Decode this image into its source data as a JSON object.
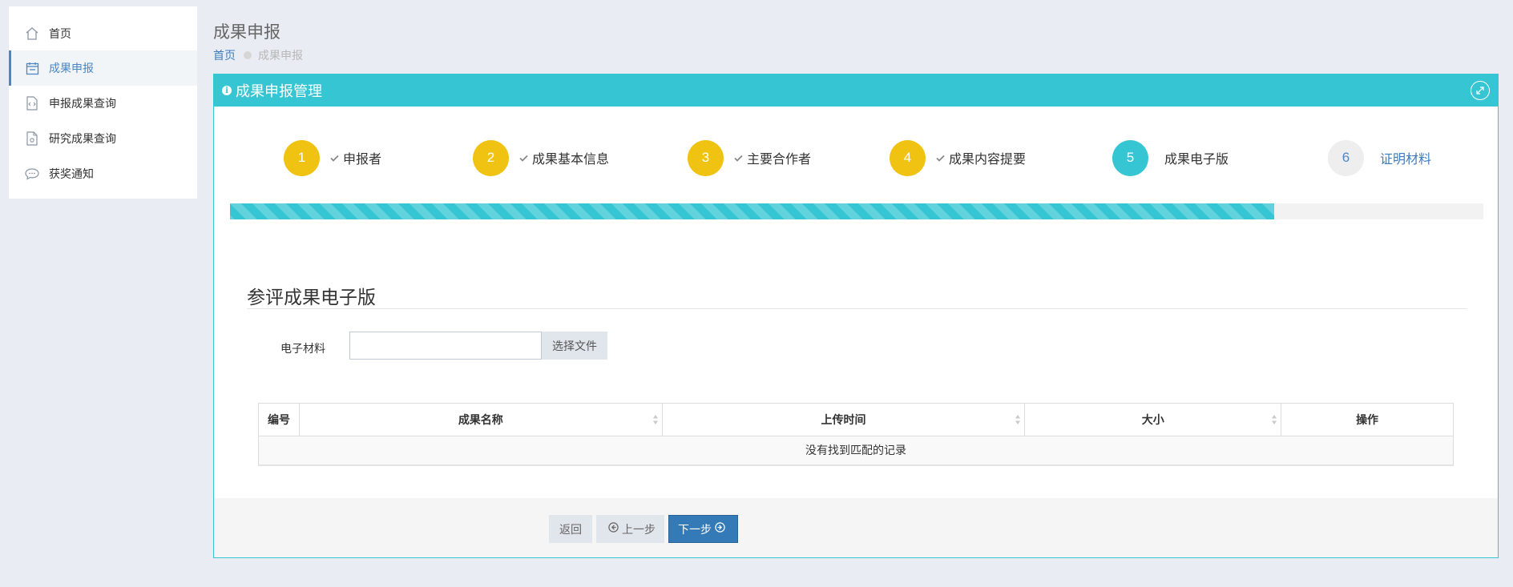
{
  "sidebar": {
    "items": [
      {
        "label": "首页",
        "icon": "home-icon"
      },
      {
        "label": "成果申报",
        "icon": "calendar-icon",
        "active": true
      },
      {
        "label": "申报成果查询",
        "icon": "code-file-icon"
      },
      {
        "label": "研究成果查询",
        "icon": "file-icon"
      },
      {
        "label": "获奖通知",
        "icon": "chat-bubble-icon"
      }
    ]
  },
  "header": {
    "title": "成果申报",
    "breadcrumb": {
      "home": "首页",
      "current": "成果申报"
    }
  },
  "portlet": {
    "title": "成果申报管理",
    "accent_color": "#36c6d3"
  },
  "steps": [
    {
      "num": "1",
      "label": "申报者",
      "state": "done"
    },
    {
      "num": "2",
      "label": "成果基本信息",
      "state": "done"
    },
    {
      "num": "3",
      "label": "主要合作者",
      "state": "done"
    },
    {
      "num": "4",
      "label": "成果内容提要",
      "state": "done"
    },
    {
      "num": "5",
      "label": "成果电子版",
      "state": "current"
    },
    {
      "num": "6",
      "label": "证明材料",
      "state": "todo"
    }
  ],
  "progress": {
    "percent": 83.33
  },
  "section": {
    "title": "参评成果电子版"
  },
  "upload": {
    "label": "电子材料",
    "button": "选择文件"
  },
  "table": {
    "columns": [
      "编号",
      "成果名称",
      "上传时间",
      "大小",
      "操作"
    ],
    "empty_text": "没有找到匹配的记录"
  },
  "actions": {
    "back": "返回",
    "prev": "上一步",
    "next": "下一步"
  }
}
